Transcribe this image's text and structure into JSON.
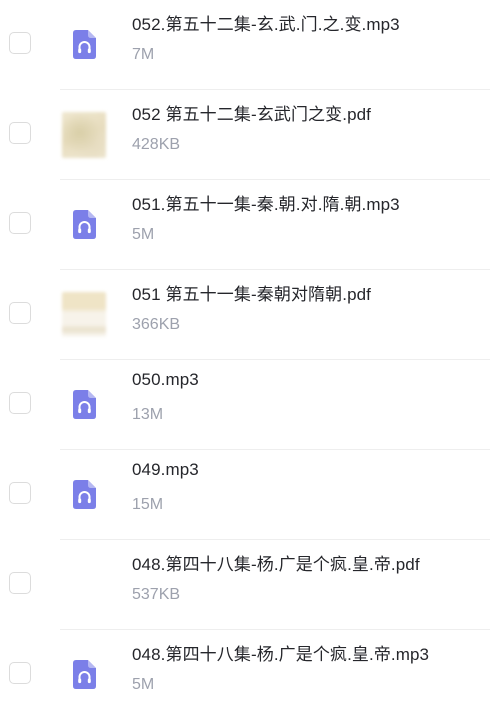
{
  "files": [
    {
      "name": "052.第五十二集-玄.武.门.之.变.mp3",
      "size": "7M",
      "type": "audio"
    },
    {
      "name": "052 第五十二集-玄武门之变.pdf",
      "size": "428KB",
      "type": "pdf"
    },
    {
      "name": "051.第五十一集-秦.朝.对.隋.朝.mp3",
      "size": "5M",
      "type": "audio"
    },
    {
      "name": "051 第五十一集-秦朝对隋朝.pdf",
      "size": "366KB",
      "type": "pdf"
    },
    {
      "name": "050.mp3",
      "size": "13M",
      "type": "audio"
    },
    {
      "name": "049.mp3",
      "size": "15M",
      "type": "audio"
    },
    {
      "name": "048.第四十八集-杨.广是个疯.皇.帝.pdf",
      "size": "537KB",
      "type": "pdf"
    },
    {
      "name": "048.第四十八集-杨.广是个疯.皇.帝.mp3",
      "size": "5M",
      "type": "audio"
    }
  ],
  "icons": {
    "audio": "headphones-file-icon",
    "pdf_thumbnail": "pdf-thumbnail"
  },
  "colors": {
    "audio_icon_fill": "#7b7fe8",
    "name_text": "#25262b",
    "size_text": "#9da1ad",
    "checkbox_border": "#dcdcdc",
    "divider": "#eeeeee"
  }
}
